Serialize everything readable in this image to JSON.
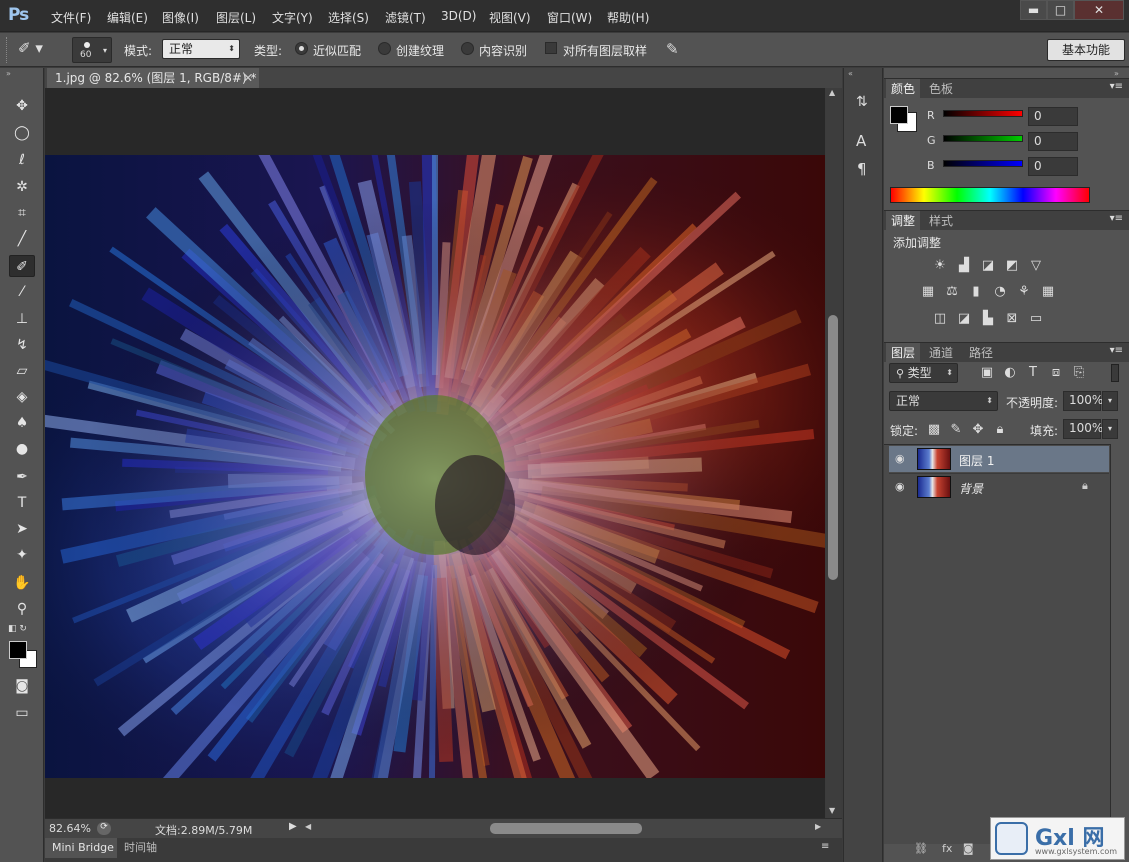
{
  "app": {
    "logo": "Ps"
  },
  "menu": [
    "文件(F)",
    "编辑(E)",
    "图像(I)",
    "图层(L)",
    "文字(Y)",
    "选择(S)",
    "滤镜(T)",
    "3D(D)",
    "视图(V)",
    "窗口(W)",
    "帮助(H)"
  ],
  "window_controls": {
    "minimize": "▬",
    "maximize": "□",
    "close": "✕"
  },
  "options": {
    "brush_size": "60",
    "mode_label": "模式:",
    "mode_value": "正常",
    "type_label": "类型:",
    "radio1": "近似匹配",
    "radio2": "创建纹理",
    "radio3": "内容识别",
    "sample_all": "对所有图层取样",
    "workspace": "基本功能"
  },
  "document": {
    "tab_title": "1.jpg @ 82.6% (图层 1, RGB/8#) *",
    "zoom": "82.64%",
    "doc_info": "文档:2.89M/5.79M"
  },
  "bottom_tabs": [
    "Mini Bridge",
    "时间轴"
  ],
  "color_panel": {
    "tabs": [
      "颜色",
      "色板"
    ],
    "channels": [
      {
        "label": "R",
        "value": "0",
        "color": "#ff0000"
      },
      {
        "label": "G",
        "value": "0",
        "color": "#00cc00"
      },
      {
        "label": "B",
        "value": "0",
        "color": "#0000ff"
      }
    ]
  },
  "adjustments_panel": {
    "tabs": [
      "调整",
      "样式"
    ],
    "heading": "添加调整"
  },
  "layers_panel": {
    "tabs": [
      "图层",
      "通道",
      "路径"
    ],
    "filter": "类型",
    "blend": "正常",
    "opacity_label": "不透明度:",
    "opacity": "100%",
    "lock_label": "锁定:",
    "fill_label": "填充:",
    "fill": "100%",
    "layers": [
      {
        "name": "图层 1",
        "selected": true
      },
      {
        "name": "背景",
        "locked": true
      }
    ]
  },
  "watermark": {
    "text": "Gxl 网",
    "sub": "www.gxlsystem.com"
  }
}
